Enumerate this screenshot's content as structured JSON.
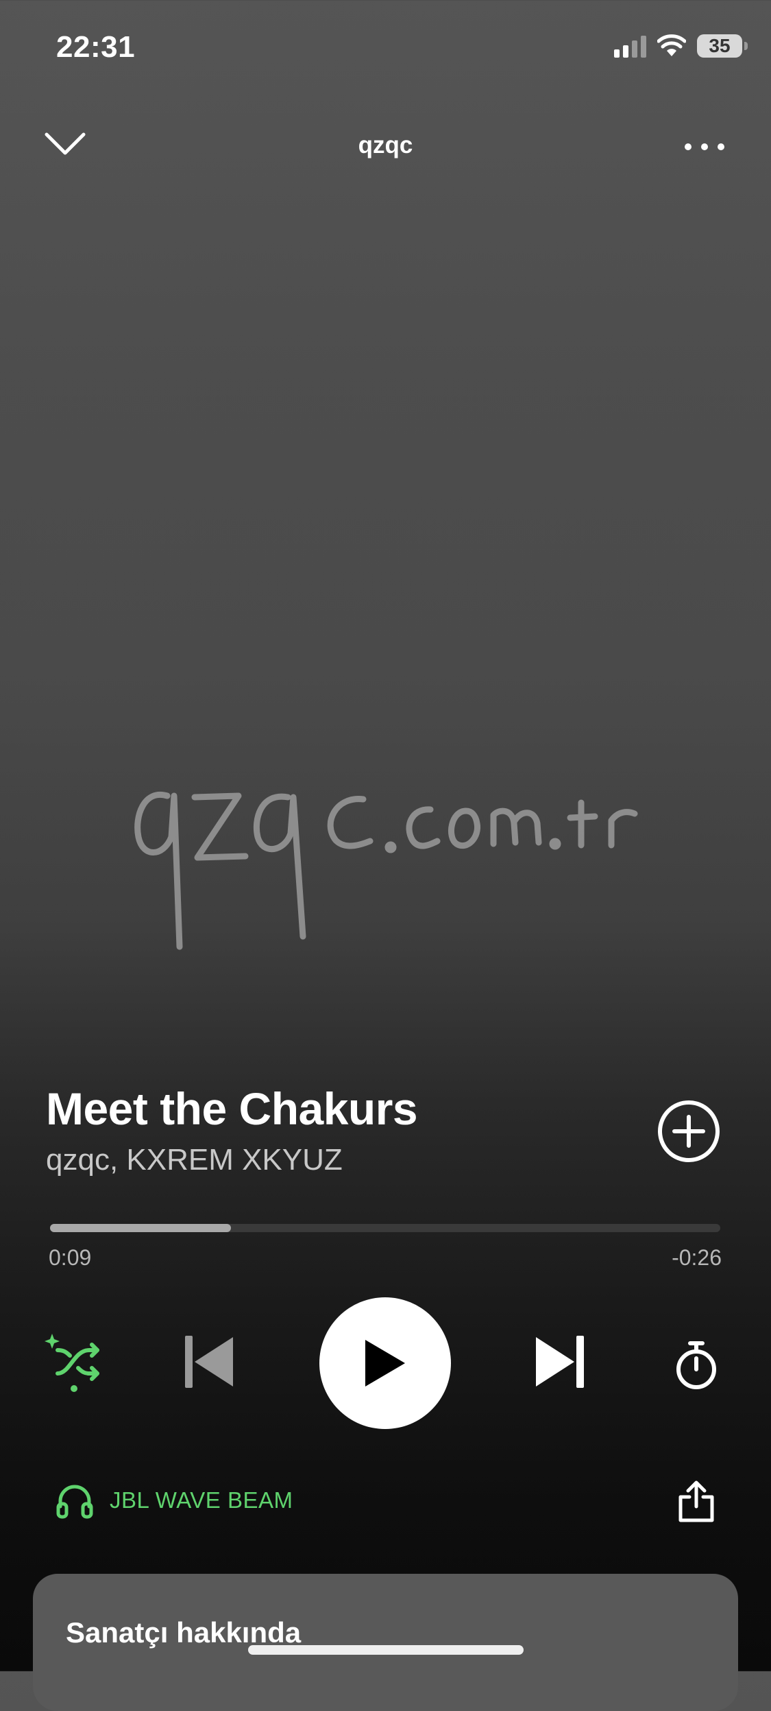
{
  "status_bar": {
    "time": "22:31",
    "battery": "35"
  },
  "header": {
    "title": "qzqc"
  },
  "artwork": {
    "watermark_text": "qzqc.com.tr"
  },
  "track": {
    "title": "Meet the Chakurs",
    "artists": "qzqc, KXREM XKYUZ"
  },
  "progress": {
    "elapsed": "0:09",
    "remaining": "-0:26",
    "fraction": 0.27
  },
  "device": {
    "name": "JBL WAVE BEAM"
  },
  "artist_card": {
    "title": "Sanatçı hakkında"
  },
  "colors": {
    "accent_green": "#5fd36d"
  },
  "icons": [
    "chevron-down-icon",
    "more-icon",
    "add-circle-icon",
    "smart-shuffle-icon",
    "previous-icon",
    "play-icon",
    "next-icon",
    "sleep-timer-icon",
    "headphones-icon",
    "share-icon"
  ]
}
